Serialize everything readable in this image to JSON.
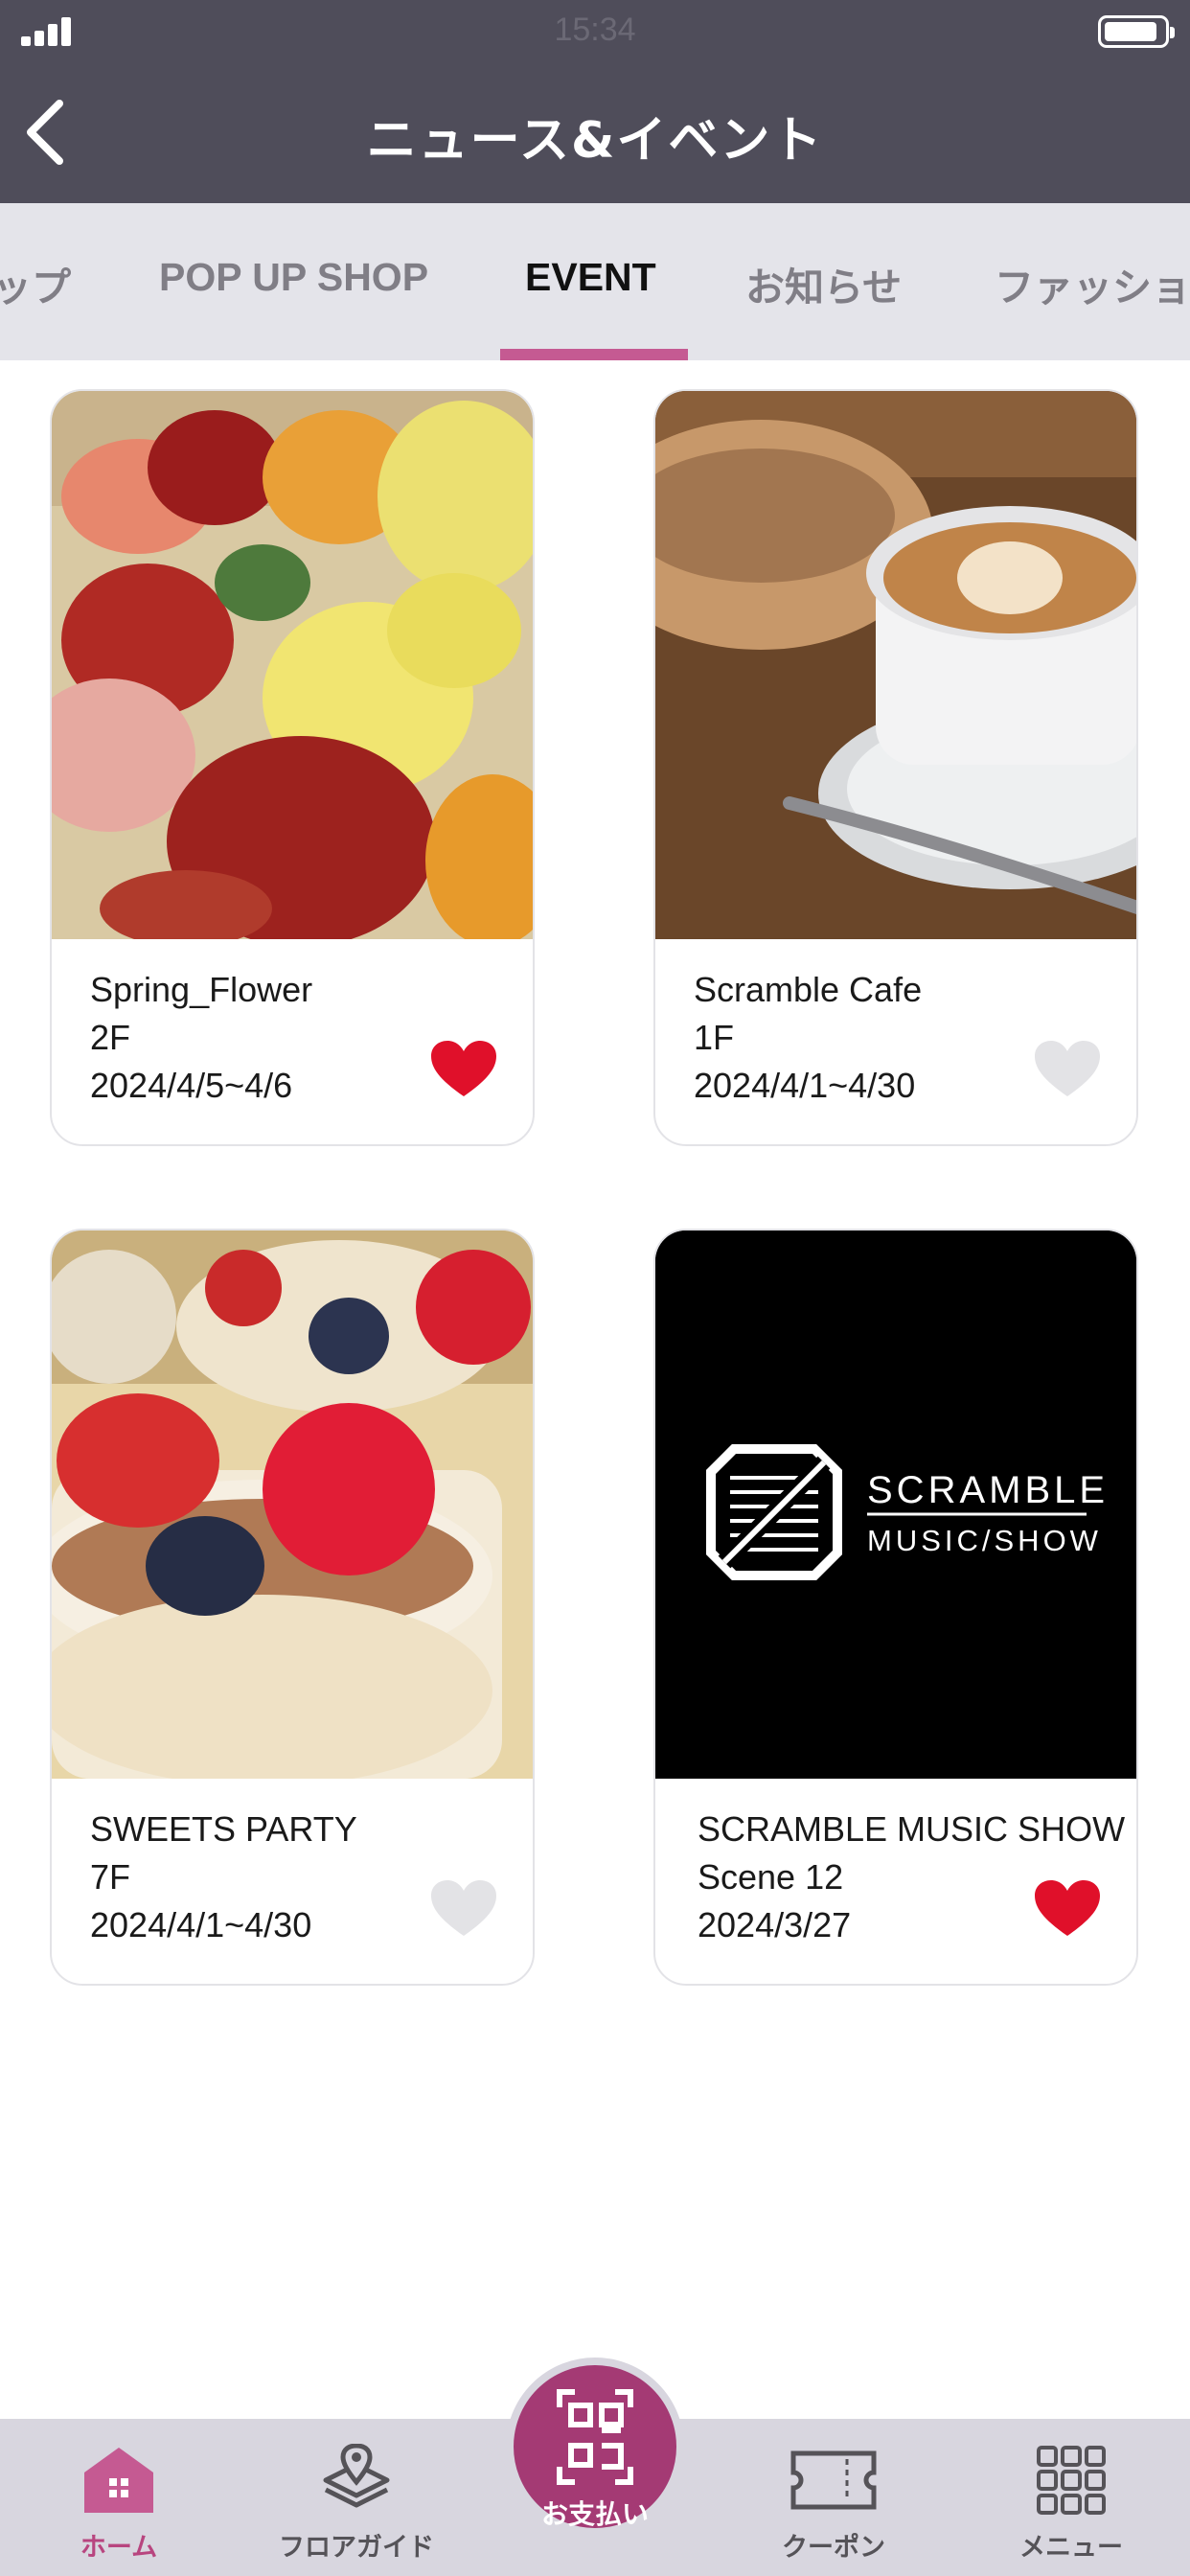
{
  "status_bar": {
    "time": "15:34"
  },
  "header": {
    "title": "ニュース&イベント"
  },
  "tabs": [
    {
      "label": "ップ"
    },
    {
      "label": "POP UP SHOP"
    },
    {
      "label": "EVENT"
    },
    {
      "label": "お知らせ"
    },
    {
      "label": "ファッショ"
    }
  ],
  "active_tab": "EVENT",
  "cards": [
    {
      "title": "Spring_Flower",
      "floor": "2F",
      "date": "2024/4/5~4/6",
      "favorited": true,
      "image": "rose bouquet photo"
    },
    {
      "title": "Scramble Cafe",
      "floor": "1F",
      "date": "2024/4/1~4/30",
      "favorited": false,
      "image": "latte and pastry photo"
    },
    {
      "title": "SWEETS PARTY",
      "floor": "7F",
      "date": "2024/4/1~4/30",
      "favorited": false,
      "image": "berry parfait photo"
    },
    {
      "title": "SCRAMBLE MUSIC SHOW",
      "floor": "Scene 12",
      "date": "2024/3/27",
      "favorited": true,
      "image": "scramble music show logo",
      "logo_text": {
        "line1": "SCRAMBLE",
        "line2": "MUSIC/SHOW"
      }
    }
  ],
  "bottom_nav": {
    "home": "ホーム",
    "floor_guide": "フロアガイド",
    "pay": "お支払い",
    "coupon": "クーポン",
    "menu": "メニュー"
  },
  "colors": {
    "header_bg": "#4f4d5a",
    "accent": "#c55a92",
    "heart_on": "#e0102a",
    "heart_off": "#e3e3e6",
    "pay_button": "#a43a74"
  },
  "icons": [
    "chevron-left-icon",
    "signal-icon",
    "battery-icon",
    "heart-icon",
    "home-icon",
    "map-pin-layers-icon",
    "qr-scan-icon",
    "ticket-icon",
    "grid-menu-icon"
  ]
}
